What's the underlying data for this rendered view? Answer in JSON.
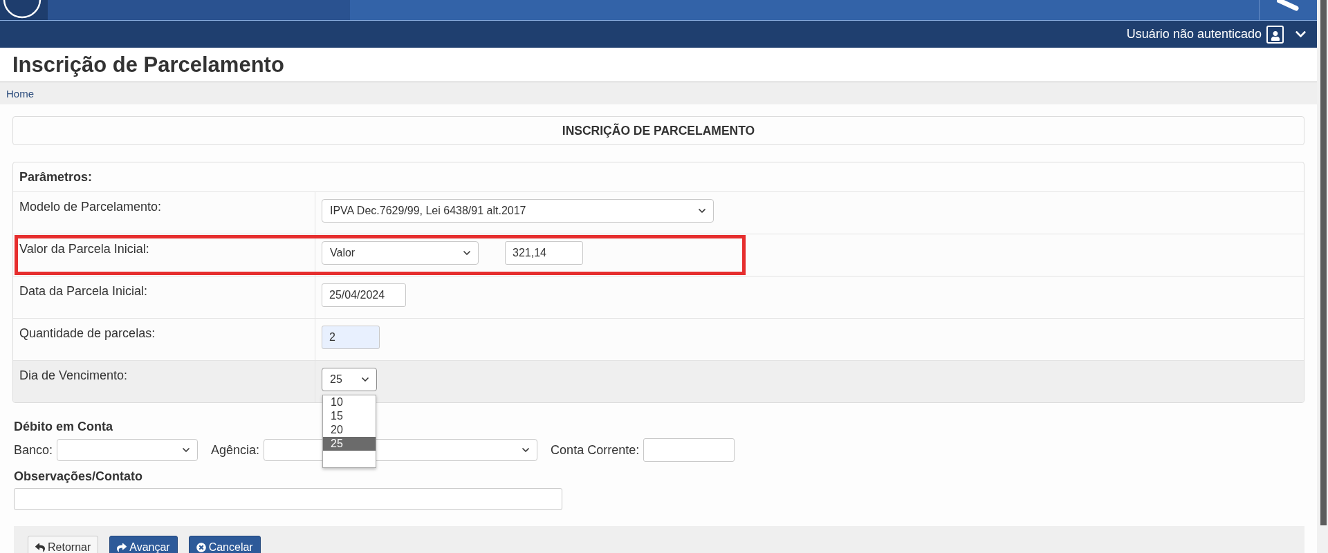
{
  "navbar": {
    "user_label": "Usuário não autenticado"
  },
  "page_title": "Inscrição de Parcelamento",
  "breadcrumb": [
    {
      "label": "Home"
    }
  ],
  "form_title": "INSCRIÇÃO DE PARCELAMENTO",
  "parameters": {
    "heading": "Parâmetros:",
    "rows": [
      {
        "label": "Modelo de Parcelamento:",
        "annotated": false,
        "hovered": false,
        "controls": [
          {
            "kind": "select",
            "value": "IPVA Dec.7629/99, Lei 6438/91 alt.2017"
          }
        ]
      },
      {
        "label": "Valor da Parcela Inicial:",
        "annotated": true,
        "hovered": false,
        "controls": [
          {
            "kind": "select",
            "value": "Valor"
          },
          {
            "kind": "input",
            "value": "321,14",
            "autofilled": false
          }
        ]
      },
      {
        "label": "Data da Parcela Inicial:",
        "annotated": false,
        "hovered": false,
        "controls": [
          {
            "kind": "input",
            "value": "25/04/2024",
            "autofilled": false
          }
        ]
      },
      {
        "label": "Quantidade de parcelas:",
        "annotated": false,
        "hovered": false,
        "controls": [
          {
            "kind": "input",
            "value": "2",
            "autofilled": true
          }
        ]
      },
      {
        "label": "Dia de Vencimento:",
        "annotated": false,
        "hovered": true,
        "controls": [
          {
            "kind": "select",
            "value": "25",
            "expanded": true,
            "options": [
              {
                "label": "10",
                "selected": false
              },
              {
                "label": "15",
                "selected": false
              },
              {
                "label": "20",
                "selected": false
              },
              {
                "label": "25",
                "selected": true
              }
            ]
          }
        ]
      }
    ]
  },
  "debit_account": {
    "heading": "Débito em Conta",
    "fields": [
      {
        "kind": "select",
        "label": "Banco:"
      },
      {
        "kind": "select",
        "label": "Agência:"
      },
      {
        "kind": "input",
        "label": "Conta Corrente:",
        "autofilled": false
      }
    ]
  },
  "notes": {
    "heading": "Observações/Contato"
  },
  "buttons": [
    {
      "label": "Retornar",
      "kind": "default"
    },
    {
      "label": "Avançar",
      "kind": "primary"
    },
    {
      "label": "Cancelar",
      "kind": "primary"
    }
  ]
}
